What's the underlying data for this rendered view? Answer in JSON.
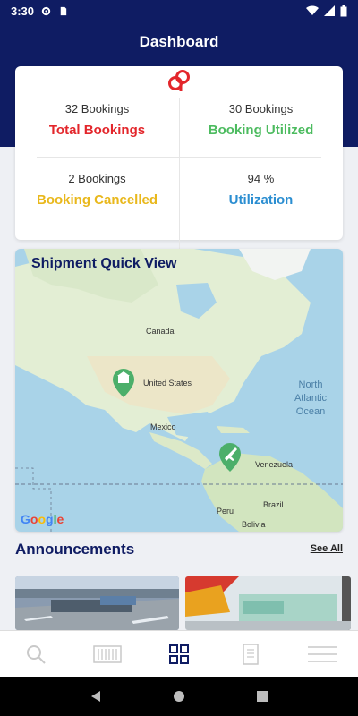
{
  "status_bar": {
    "time": "3:30"
  },
  "header": {
    "title": "Dashboard"
  },
  "stats": [
    {
      "count": "32 Bookings",
      "label": "Total Bookings",
      "color": "#e3262b"
    },
    {
      "count": "30 Bookings",
      "label": "Booking Utilized",
      "color": "#4cbb5f"
    },
    {
      "count": "2 Bookings",
      "label": "Booking Cancelled",
      "color": "#e9b81c"
    },
    {
      "count": "94 %",
      "label": "Utilization",
      "color": "#2b8ed1"
    }
  ],
  "map": {
    "title": "Shipment Quick View",
    "labels": {
      "canada": "Canada",
      "us": "United States",
      "mexico": "Mexico",
      "venezuela": "Venezuela",
      "peru": "Peru",
      "brazil": "Brazil",
      "bolivia": "Bolivia",
      "ocean": "North Atlantic Ocean"
    },
    "attribution": "Google",
    "markers": [
      {
        "type": "warehouse-icon",
        "color": "#4caf6a"
      },
      {
        "type": "airplane-icon",
        "color": "#4caf6a"
      }
    ]
  },
  "announcements": {
    "title": "Announcements",
    "see_all": "See All"
  },
  "tabs": [
    {
      "icon": "search-icon"
    },
    {
      "icon": "container-icon"
    },
    {
      "icon": "dashboard-grid-icon",
      "active": true
    },
    {
      "icon": "document-icon"
    },
    {
      "icon": "menu-icon"
    }
  ],
  "colors": {
    "primary": "#0f1c63",
    "brand_red": "#e3262b"
  }
}
